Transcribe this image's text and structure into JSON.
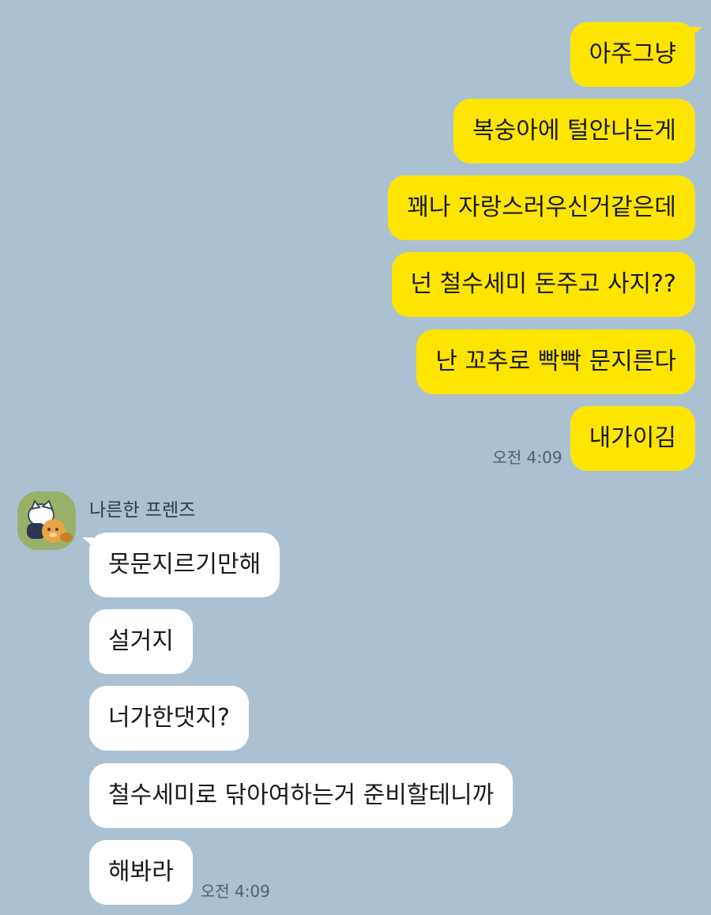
{
  "outgoing": [
    {
      "text": "아주그냥"
    },
    {
      "text": "복숭아에 털안나는게"
    },
    {
      "text": "꽤나 자랑스러우신거같은데"
    },
    {
      "text": "넌 철수세미 돈주고 사지??"
    },
    {
      "text": "난 꼬추로 빡빡 문지른다"
    },
    {
      "text": "내가이김",
      "time": "오전 4:09"
    }
  ],
  "incoming": {
    "sender": "나른한 프렌즈",
    "avatar_icon": "kakao-friends-avatar-icon",
    "messages": [
      {
        "text": "못문지르기만해"
      },
      {
        "text": "설거지"
      },
      {
        "text": "너가한댓지?"
      },
      {
        "text": "철수세미로 닦아여하는거 준비할테니까"
      },
      {
        "text": "해봐라",
        "time": "오전 4:09"
      }
    ]
  },
  "colors": {
    "background": "#abc1d1",
    "outgoing_bubble": "#fee500",
    "incoming_bubble": "#ffffff"
  }
}
